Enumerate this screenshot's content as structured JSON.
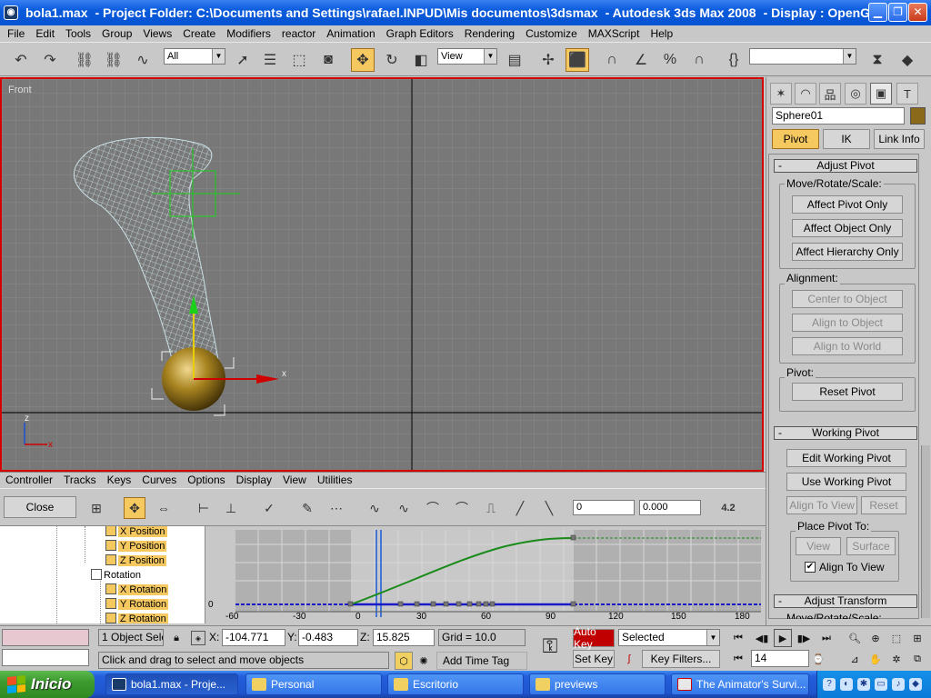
{
  "title": {
    "file": "bola1.max",
    "project": "- Project Folder: C:\\Documents and Settings\\rafael.INPUD\\Mis documentos\\3dsmax",
    "app": "- Autodesk 3ds Max 2008",
    "display": "- Display : OpenGL"
  },
  "menu": [
    "File",
    "Edit",
    "Tools",
    "Group",
    "Views",
    "Create",
    "Modifiers",
    "reactor",
    "Animation",
    "Graph Editors",
    "Rendering",
    "Customize",
    "MAXScript",
    "Help"
  ],
  "toolbar": {
    "selection_filter": "All",
    "ref_coord": "View",
    "named_selection": ""
  },
  "viewport": {
    "label": "Front",
    "axis_x": "x",
    "axis_z": "z"
  },
  "command_panel": {
    "object_name": "Sphere01",
    "object_color": "#8a6a1a",
    "tabs": [
      "Pivot",
      "IK",
      "Link Info"
    ],
    "adjust_pivot": {
      "title": "Adjust Pivot",
      "move_group": "Move/Rotate/Scale:",
      "affect_pivot_only": "Affect Pivot Only",
      "affect_object_only": "Affect Object Only",
      "affect_hierarchy_only": "Affect Hierarchy Only",
      "alignment_group": "Alignment:",
      "center_to_object": "Center to Object",
      "align_to_object": "Align to Object",
      "align_to_world": "Align to World",
      "pivot_group": "Pivot:",
      "reset_pivot": "Reset Pivot"
    },
    "working_pivot": {
      "title": "Working Pivot",
      "edit_working_pivot": "Edit Working Pivot",
      "use_working_pivot": "Use Working Pivot",
      "align_to_view": "Align To View",
      "reset": "Reset",
      "place_pivot_group": "Place Pivot To:",
      "view": "View",
      "surface": "Surface",
      "align_to_view_check": "Align To View"
    },
    "adjust_transform": {
      "title": "Adjust Transform",
      "move_group": "Move/Rotate/Scale:"
    }
  },
  "curve_editor": {
    "menu": [
      "Controller",
      "Tracks",
      "Keys",
      "Curves",
      "Options",
      "Display",
      "View",
      "Utilities"
    ],
    "close_label": "Close",
    "frame_field": "0",
    "value_field": "0.000",
    "zoom_value": "4.2",
    "tracks": [
      {
        "label": "X Position"
      },
      {
        "label": "Y Position"
      },
      {
        "label": "Z Position"
      },
      {
        "label": "Rotation"
      },
      {
        "label": "X Rotation"
      },
      {
        "label": "Y Rotation"
      },
      {
        "label": "Z Rotation"
      }
    ],
    "ruler": [
      "-60",
      "-30",
      "0",
      "30",
      "60",
      "90",
      "120",
      "150",
      "180"
    ],
    "value_label": "0"
  },
  "status": {
    "selection_count": "1 Object Sele",
    "x_label": "X:",
    "x_value": "-104.771",
    "y_label": "Y:",
    "y_value": "-0.483",
    "z_label": "Z:",
    "z_value": "15.825",
    "grid": "Grid = 10.0",
    "auto_key": "Auto Key",
    "key_mode": "Selected",
    "set_key": "Set Key",
    "key_filters": "Key Filters...",
    "current_frame": "14",
    "prompt": "Click and drag to select and move objects",
    "add_time_tag": "Add Time Tag"
  },
  "taskbar": {
    "start": "Inicio",
    "tasks": [
      {
        "label": "bola1.max      - Proje..."
      },
      {
        "label": "Personal"
      },
      {
        "label": "Escritorio"
      },
      {
        "label": "previews"
      },
      {
        "label": "The Animator's Survi..."
      }
    ]
  }
}
